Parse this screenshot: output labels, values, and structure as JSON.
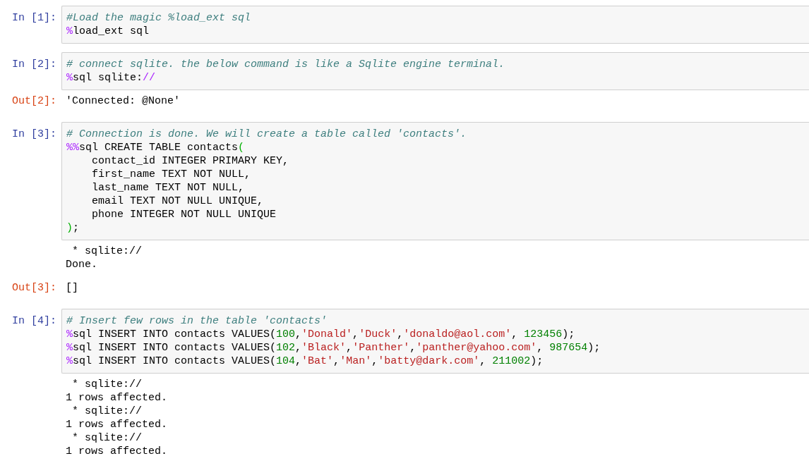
{
  "cells": [
    {
      "prompt": "In [1]:",
      "lines": [
        [
          {
            "kind": "comment",
            "text": "#Load the magic %load_ext sql"
          }
        ],
        [
          {
            "kind": "magic",
            "text": "%"
          },
          {
            "kind": "plain",
            "text": "load_ext sql"
          }
        ]
      ]
    },
    {
      "prompt": "In [2]:",
      "lines": [
        [
          {
            "kind": "comment",
            "text": "# connect sqlite. the below command is like a Sqlite engine terminal."
          }
        ],
        [
          {
            "kind": "magic",
            "text": "%"
          },
          {
            "kind": "plain",
            "text": "sql sqlite:"
          },
          {
            "kind": "magic",
            "text": "//"
          }
        ]
      ],
      "outputs": [
        {
          "kind": "result",
          "prompt": "Out[2]:",
          "lines": [
            "'Connected: @None'"
          ]
        }
      ]
    },
    {
      "prompt": "In [3]:",
      "lines": [
        [
          {
            "kind": "comment",
            "text": "# Connection is done. We will create a table called 'contacts'."
          }
        ],
        [
          {
            "kind": "magic",
            "text": "%%"
          },
          {
            "kind": "plain",
            "text": "sql CREATE TABLE contacts"
          },
          {
            "kind": "paren",
            "text": "("
          }
        ],
        [
          {
            "kind": "plain",
            "text": "    contact_id INTEGER PRIMARY KEY,"
          }
        ],
        [
          {
            "kind": "plain",
            "text": "    first_name TEXT NOT NULL,"
          }
        ],
        [
          {
            "kind": "plain",
            "text": "    last_name TEXT NOT NULL,"
          }
        ],
        [
          {
            "kind": "plain",
            "text": "    email TEXT NOT NULL UNIQUE,"
          }
        ],
        [
          {
            "kind": "plain",
            "text": "    phone INTEGER NOT NULL UNIQUE"
          }
        ],
        [
          {
            "kind": "paren",
            "text": ")"
          },
          {
            "kind": "plain",
            "text": ";"
          }
        ]
      ],
      "outputs": [
        {
          "kind": "stream",
          "lines": [
            " * sqlite://",
            "Done."
          ]
        },
        {
          "kind": "result",
          "prompt": "Out[3]:",
          "lines": [
            "[]"
          ]
        }
      ]
    },
    {
      "prompt": "In [4]:",
      "lines": [
        [
          {
            "kind": "comment",
            "text": "# Insert few rows in the table 'contacts'"
          }
        ],
        [
          {
            "kind": "magic",
            "text": "%"
          },
          {
            "kind": "plain",
            "text": "sql INSERT INTO contacts VALUES("
          },
          {
            "kind": "number",
            "text": "100"
          },
          {
            "kind": "plain",
            "text": ","
          },
          {
            "kind": "string",
            "text": "'Donald'"
          },
          {
            "kind": "plain",
            "text": ","
          },
          {
            "kind": "string",
            "text": "'Duck'"
          },
          {
            "kind": "plain",
            "text": ","
          },
          {
            "kind": "string",
            "text": "'donaldo@aol.com'"
          },
          {
            "kind": "plain",
            "text": ", "
          },
          {
            "kind": "number",
            "text": "123456"
          },
          {
            "kind": "plain",
            "text": ");"
          }
        ],
        [
          {
            "kind": "magic",
            "text": "%"
          },
          {
            "kind": "plain",
            "text": "sql INSERT INTO contacts VALUES("
          },
          {
            "kind": "number",
            "text": "102"
          },
          {
            "kind": "plain",
            "text": ","
          },
          {
            "kind": "string",
            "text": "'Black'"
          },
          {
            "kind": "plain",
            "text": ","
          },
          {
            "kind": "string",
            "text": "'Panther'"
          },
          {
            "kind": "plain",
            "text": ","
          },
          {
            "kind": "string",
            "text": "'panther@yahoo.com'"
          },
          {
            "kind": "plain",
            "text": ", "
          },
          {
            "kind": "number",
            "text": "987654"
          },
          {
            "kind": "plain",
            "text": ");"
          }
        ],
        [
          {
            "kind": "magic",
            "text": "%"
          },
          {
            "kind": "plain",
            "text": "sql INSERT INTO contacts VALUES("
          },
          {
            "kind": "number",
            "text": "104"
          },
          {
            "kind": "plain",
            "text": ","
          },
          {
            "kind": "string",
            "text": "'Bat'"
          },
          {
            "kind": "plain",
            "text": ","
          },
          {
            "kind": "string",
            "text": "'Man'"
          },
          {
            "kind": "plain",
            "text": ","
          },
          {
            "kind": "string",
            "text": "'batty@dark.com'"
          },
          {
            "kind": "plain",
            "text": ", "
          },
          {
            "kind": "number",
            "text": "211002"
          },
          {
            "kind": "plain",
            "text": ");"
          }
        ]
      ],
      "outputs": [
        {
          "kind": "stream",
          "lines": [
            " * sqlite://",
            "1 rows affected.",
            " * sqlite://",
            "1 rows affected.",
            " * sqlite://",
            "1 rows affected."
          ]
        }
      ]
    }
  ]
}
